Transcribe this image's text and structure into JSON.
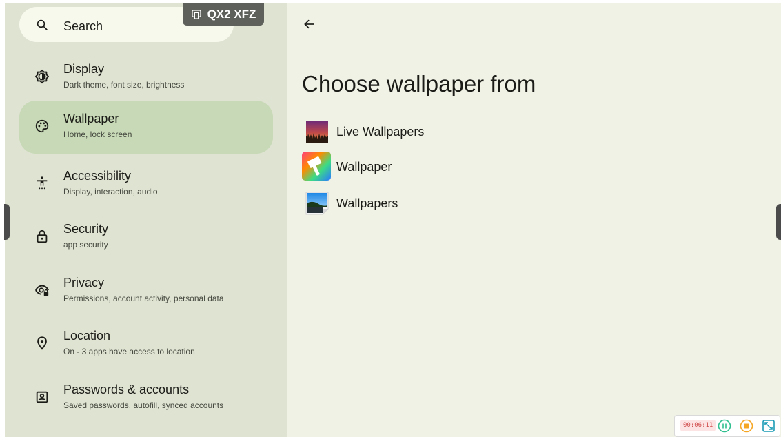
{
  "search": {
    "label": "Search",
    "icon": "search-icon"
  },
  "device_tag": {
    "text": "QX2 XFZ",
    "icon": "cast-device-icon"
  },
  "sidebar": {
    "items": [
      {
        "title": "Display",
        "subtitle": "Dark theme, font size, brightness",
        "icon": "brightness-icon",
        "selected": false
      },
      {
        "title": "Wallpaper",
        "subtitle": "Home, lock screen",
        "icon": "palette-icon",
        "selected": true
      },
      {
        "title": "Accessibility",
        "subtitle": "Display, interaction, audio",
        "icon": "accessibility-icon",
        "selected": false
      },
      {
        "title": "Security",
        "subtitle": "app security",
        "icon": "lock-icon",
        "selected": false
      },
      {
        "title": "Privacy",
        "subtitle": "Permissions, account activity, personal data",
        "icon": "privacy-eye-icon",
        "selected": false
      },
      {
        "title": "Location",
        "subtitle": "On - 3 apps have access to location",
        "icon": "location-pin-icon",
        "selected": false
      },
      {
        "title": "Passwords & accounts",
        "subtitle": "Saved passwords, autofill, synced accounts",
        "icon": "account-box-icon",
        "selected": false
      }
    ]
  },
  "main": {
    "heading": "Choose wallpaper from",
    "back_icon": "back-arrow-icon",
    "options": [
      {
        "label": "Live Wallpapers",
        "icon": "live-wallpapers-icon"
      },
      {
        "label": "Wallpaper",
        "icon": "wallpaper-app-icon"
      },
      {
        "label": "Wallpapers",
        "icon": "wallpapers-gallery-icon"
      }
    ]
  },
  "recorder": {
    "timer": "00:06:11",
    "pause_icon": "pause-icon",
    "stop_icon": "stop-icon",
    "expand_icon": "expand-icon"
  },
  "colors": {
    "sidebar_bg": "#dfe3d2",
    "content_bg": "#f1f2e6",
    "selected_bg": "#c7d9b6",
    "recorder_green": "#2fbf8f",
    "recorder_orange": "#f5a623",
    "recorder_teal": "#1a9bb5"
  }
}
